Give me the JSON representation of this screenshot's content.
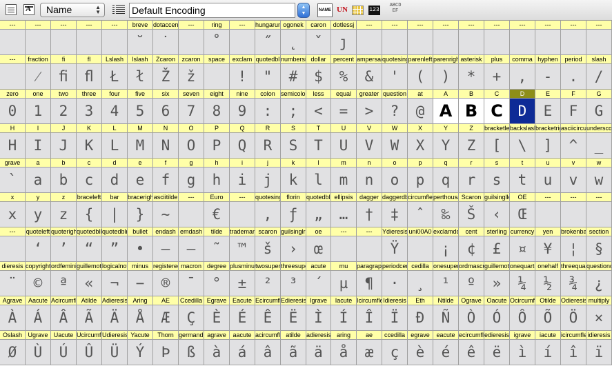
{
  "toolbar": {
    "name_select": "Name",
    "encoding": "Default Encoding",
    "name_view_button": "NAME",
    "unicode_view_button": "UN",
    "code_view_button": "123",
    "sample_view_button": "ABCD EF"
  },
  "grid": {
    "columns": 24,
    "bold_glyphs": [
      "A",
      "B",
      "C"
    ],
    "selected_glyph": "D",
    "rows": [
      {
        "names": [
          "---",
          "---",
          "---",
          "---",
          "---",
          "breve",
          "dotaccent",
          "---",
          "ring",
          "---",
          "hungarumlaut",
          "ogonek",
          "caron",
          "dotlessj",
          "---",
          "---",
          "---",
          "---",
          "---",
          "---",
          "---",
          "---",
          "---",
          "---"
        ],
        "chars": [
          "",
          "",
          "",
          "",
          "",
          "˘",
          "˙",
          "",
          "˚",
          "",
          "˝",
          "˛",
          "ˇ",
          "ȷ",
          "",
          "",
          "",
          "",
          "",
          "",
          "",
          "",
          "",
          ""
        ]
      },
      {
        "names": [
          "---",
          "fraction",
          "fi",
          "fl",
          "Lslash",
          "lslash",
          "Zcaron",
          "zcaron",
          "space",
          "exclam",
          "quotedbl",
          "numbersign",
          "dollar",
          "percent",
          "ampersand",
          "quotesingle",
          "parenleft",
          "parenright",
          "asterisk",
          "plus",
          "comma",
          "hyphen",
          "period",
          "slash"
        ],
        "chars": [
          "",
          "⁄",
          "ﬁ",
          "ﬂ",
          "Ł",
          "ł",
          "Ž",
          "ž",
          "",
          "!",
          "\"",
          "#",
          "$",
          "%",
          "&",
          "'",
          "(",
          ")",
          "*",
          "+",
          ",",
          "-",
          ".",
          "/"
        ]
      },
      {
        "names": [
          "zero",
          "one",
          "two",
          "three",
          "four",
          "five",
          "six",
          "seven",
          "eight",
          "nine",
          "colon",
          "semicolon",
          "less",
          "equal",
          "greater",
          "question",
          "at",
          "A",
          "B",
          "C",
          "D",
          "E",
          "F",
          "G"
        ],
        "chars": [
          "0",
          "1",
          "2",
          "3",
          "4",
          "5",
          "6",
          "7",
          "8",
          "9",
          ":",
          ";",
          "<",
          "=",
          ">",
          "?",
          "@",
          "A",
          "B",
          "C",
          "D",
          "E",
          "F",
          "G"
        ]
      },
      {
        "names": [
          "H",
          "I",
          "J",
          "K",
          "L",
          "M",
          "N",
          "O",
          "P",
          "Q",
          "R",
          "S",
          "T",
          "U",
          "V",
          "W",
          "X",
          "Y",
          "Z",
          "bracketleft",
          "backslash",
          "bracketright",
          "asciicircum",
          "underscore"
        ],
        "chars": [
          "H",
          "I",
          "J",
          "K",
          "L",
          "M",
          "N",
          "O",
          "P",
          "Q",
          "R",
          "S",
          "T",
          "U",
          "V",
          "W",
          "X",
          "Y",
          "Z",
          "[",
          "\\",
          "]",
          "^",
          "_"
        ]
      },
      {
        "names": [
          "grave",
          "a",
          "b",
          "c",
          "d",
          "e",
          "f",
          "g",
          "h",
          "i",
          "j",
          "k",
          "l",
          "m",
          "n",
          "o",
          "p",
          "q",
          "r",
          "s",
          "t",
          "u",
          "v",
          "w"
        ],
        "chars": [
          "`",
          "a",
          "b",
          "c",
          "d",
          "e",
          "f",
          "g",
          "h",
          "i",
          "j",
          "k",
          "l",
          "m",
          "n",
          "o",
          "p",
          "q",
          "r",
          "s",
          "t",
          "u",
          "v",
          "w"
        ]
      },
      {
        "names": [
          "x",
          "y",
          "z",
          "braceleft",
          "bar",
          "braceright",
          "asciitilde",
          "---",
          "Euro",
          "---",
          "quotesinglbase",
          "florin",
          "quotedblbase",
          "ellipsis",
          "dagger",
          "daggerdbl",
          "circumflex",
          "perthousand",
          "Scaron",
          "guilsinglleft",
          "OE",
          "---",
          "---",
          "---"
        ],
        "chars": [
          "x",
          "y",
          "z",
          "{",
          "|",
          "}",
          "~",
          "",
          "€",
          "",
          "‚",
          "ƒ",
          "„",
          "…",
          "†",
          "‡",
          "ˆ",
          "‰",
          "Š",
          "‹",
          "Œ",
          "",
          "",
          ""
        ]
      },
      {
        "names": [
          "---",
          "quoteleft",
          "quoteright",
          "quotedblleft",
          "quotedblright",
          "bullet",
          "endash",
          "emdash",
          "tilde",
          "trademark",
          "scaron",
          "guilsinglright",
          "oe",
          "---",
          "---",
          "Ydieresis",
          "uni00A0",
          "exclamdown",
          "cent",
          "sterling",
          "currency",
          "yen",
          "brokenbar",
          "section"
        ],
        "chars": [
          "",
          "‘",
          "’",
          "“",
          "”",
          "•",
          "–",
          "—",
          "˜",
          "™",
          "š",
          "›",
          "œ",
          "",
          "",
          "Ÿ",
          "",
          "¡",
          "¢",
          "£",
          "¤",
          "¥",
          "¦",
          "§"
        ]
      },
      {
        "names": [
          "dieresis",
          "copyright",
          "ordfeminine",
          "guillemotleft",
          "logicalnot",
          "minus",
          "registered",
          "macron",
          "degree",
          "plusminus",
          "twosuperior",
          "threesuperior",
          "acute",
          "mu",
          "paragraph",
          "periodcentered",
          "cedilla",
          "onesuperior",
          "ordmasculine",
          "guillemotright",
          "onequarter",
          "onehalf",
          "threequarters",
          "questiondown"
        ],
        "chars": [
          "¨",
          "©",
          "ª",
          "«",
          "¬",
          "−",
          "®",
          "¯",
          "°",
          "±",
          "²",
          "³",
          "´",
          "µ",
          "¶",
          "·",
          "¸",
          "¹",
          "º",
          "»",
          "¼",
          "½",
          "¾",
          "¿"
        ]
      },
      {
        "names": [
          "Agrave",
          "Aacute",
          "Acircumflex",
          "Atilde",
          "Adieresis",
          "Aring",
          "AE",
          "Ccedilla",
          "Egrave",
          "Eacute",
          "Ecircumflex",
          "Edieresis",
          "Igrave",
          "Iacute",
          "Icircumflex",
          "Idieresis",
          "Eth",
          "Ntilde",
          "Ograve",
          "Oacute",
          "Ocircumflex",
          "Otilde",
          "Odieresis",
          "multiply"
        ],
        "chars": [
          "À",
          "Á",
          "Â",
          "Ã",
          "Ä",
          "Å",
          "Æ",
          "Ç",
          "È",
          "É",
          "Ê",
          "Ë",
          "Ì",
          "Í",
          "Î",
          "Ï",
          "Ð",
          "Ñ",
          "Ò",
          "Ó",
          "Ô",
          "Õ",
          "Ö",
          "×"
        ]
      },
      {
        "names": [
          "Oslash",
          "Ugrave",
          "Uacute",
          "Ucircumflex",
          "Udieresis",
          "Yacute",
          "Thorn",
          "germandbls",
          "agrave",
          "aacute",
          "acircumflex",
          "atilde",
          "adieresis",
          "aring",
          "ae",
          "ccedilla",
          "egrave",
          "eacute",
          "ecircumflex",
          "edieresis",
          "igrave",
          "iacute",
          "icircumflex",
          "idieresis"
        ],
        "chars": [
          "Ø",
          "Ù",
          "Ú",
          "Û",
          "Ü",
          "Ý",
          "Þ",
          "ß",
          "à",
          "á",
          "â",
          "ã",
          "ä",
          "å",
          "æ",
          "ç",
          "è",
          "é",
          "ê",
          "ë",
          "ì",
          "í",
          "î",
          "ï"
        ]
      }
    ]
  }
}
